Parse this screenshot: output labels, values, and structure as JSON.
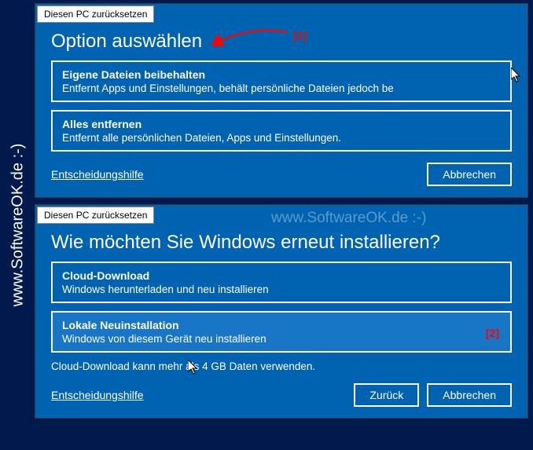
{
  "side_text": "www.SoftwareOK.de :-)",
  "watermark": "www.SoftwareOK.de :-)",
  "dialog1": {
    "title": "Diesen PC zurücksetzen",
    "heading": "Option auswählen",
    "options": [
      {
        "title": "Eigene Dateien beibehalten",
        "desc": "Entfernt Apps und Einstellungen, behält persönliche Dateien jedoch be"
      },
      {
        "title": "Alles entfernen",
        "desc": "Entfernt alle persönlichen Dateien, Apps und Einstellungen."
      }
    ],
    "help": "Entscheidungshilfe",
    "cancel": "Abbrechen",
    "annotation": "[1]"
  },
  "dialog2": {
    "title": "Diesen PC zurücksetzen",
    "heading": "Wie möchten Sie Windows erneut installieren?",
    "options": [
      {
        "title": "Cloud-Download",
        "desc": "Windows herunterladen und neu installieren"
      },
      {
        "title": "Lokale Neuinstallation",
        "desc": "Windows von diesem Gerät neu installieren"
      }
    ],
    "note": "Cloud-Download kann mehr als 4 GB Daten verwenden.",
    "help": "Entscheidungshilfe",
    "back": "Zurück",
    "cancel": "Abbrechen",
    "annotation": "[2]"
  }
}
